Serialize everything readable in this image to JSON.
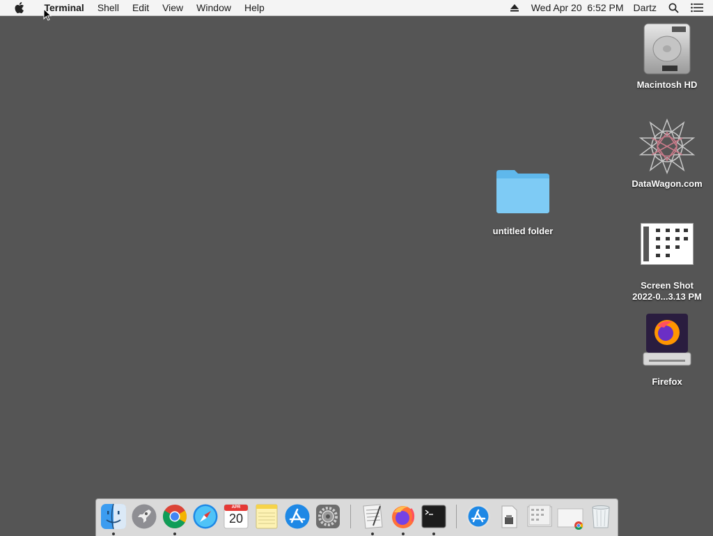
{
  "menubar": {
    "apple_icon": "apple-logo-icon",
    "app_name": "Terminal",
    "menus": [
      "Shell",
      "Edit",
      "View",
      "Window",
      "Help"
    ],
    "eject_icon": "eject-icon",
    "datetime": "Wed Apr 20  6:52 PM",
    "user": "Dartz",
    "search_icon": "spotlight-search-icon",
    "notification_icon": "notification-center-icon"
  },
  "desktop": {
    "background_color": "#555555",
    "icons": [
      {
        "label": "Macintosh HD",
        "icon": "hard-drive-icon"
      },
      {
        "label": "DataWagon.com",
        "icon": "geometric-star-icon"
      },
      {
        "label": "Screen Shot",
        "label2": "2022-0...3.13 PM",
        "icon": "screenshot-thumbnail-icon"
      },
      {
        "label": "Firefox",
        "icon": "firefox-disk-image-icon"
      },
      {
        "label": "untitled folder",
        "icon": "folder-icon"
      }
    ]
  },
  "dock": {
    "items": [
      {
        "name": "Finder",
        "icon": "finder-icon",
        "running": true
      },
      {
        "name": "Launchpad",
        "icon": "launchpad-icon",
        "running": false
      },
      {
        "name": "Google Chrome",
        "icon": "chrome-icon",
        "running": true
      },
      {
        "name": "Safari",
        "icon": "safari-icon",
        "running": false
      },
      {
        "name": "Calendar",
        "icon": "calendar-icon",
        "running": false,
        "month": "APR",
        "day": "20"
      },
      {
        "name": "Notes",
        "icon": "notes-icon",
        "running": false
      },
      {
        "name": "App Store",
        "icon": "app-store-icon",
        "running": false
      },
      {
        "name": "System Preferences",
        "icon": "system-preferences-icon",
        "running": false
      },
      {
        "name": "TextEdit",
        "icon": "textedit-icon",
        "running": true
      },
      {
        "name": "Firefox",
        "icon": "firefox-icon",
        "running": true
      },
      {
        "name": "Terminal",
        "icon": "terminal-icon",
        "running": true
      },
      {
        "name": "Applications",
        "icon": "applications-folder-icon",
        "running": false
      },
      {
        "name": "Documents",
        "icon": "document-stack-icon",
        "running": false
      },
      {
        "name": "Screenshot stack",
        "icon": "screenshot-stack-icon",
        "running": false
      },
      {
        "name": "Chrome download",
        "icon": "chrome-download-icon",
        "running": false
      },
      {
        "name": "Trash",
        "icon": "trash-icon",
        "running": false
      }
    ]
  }
}
